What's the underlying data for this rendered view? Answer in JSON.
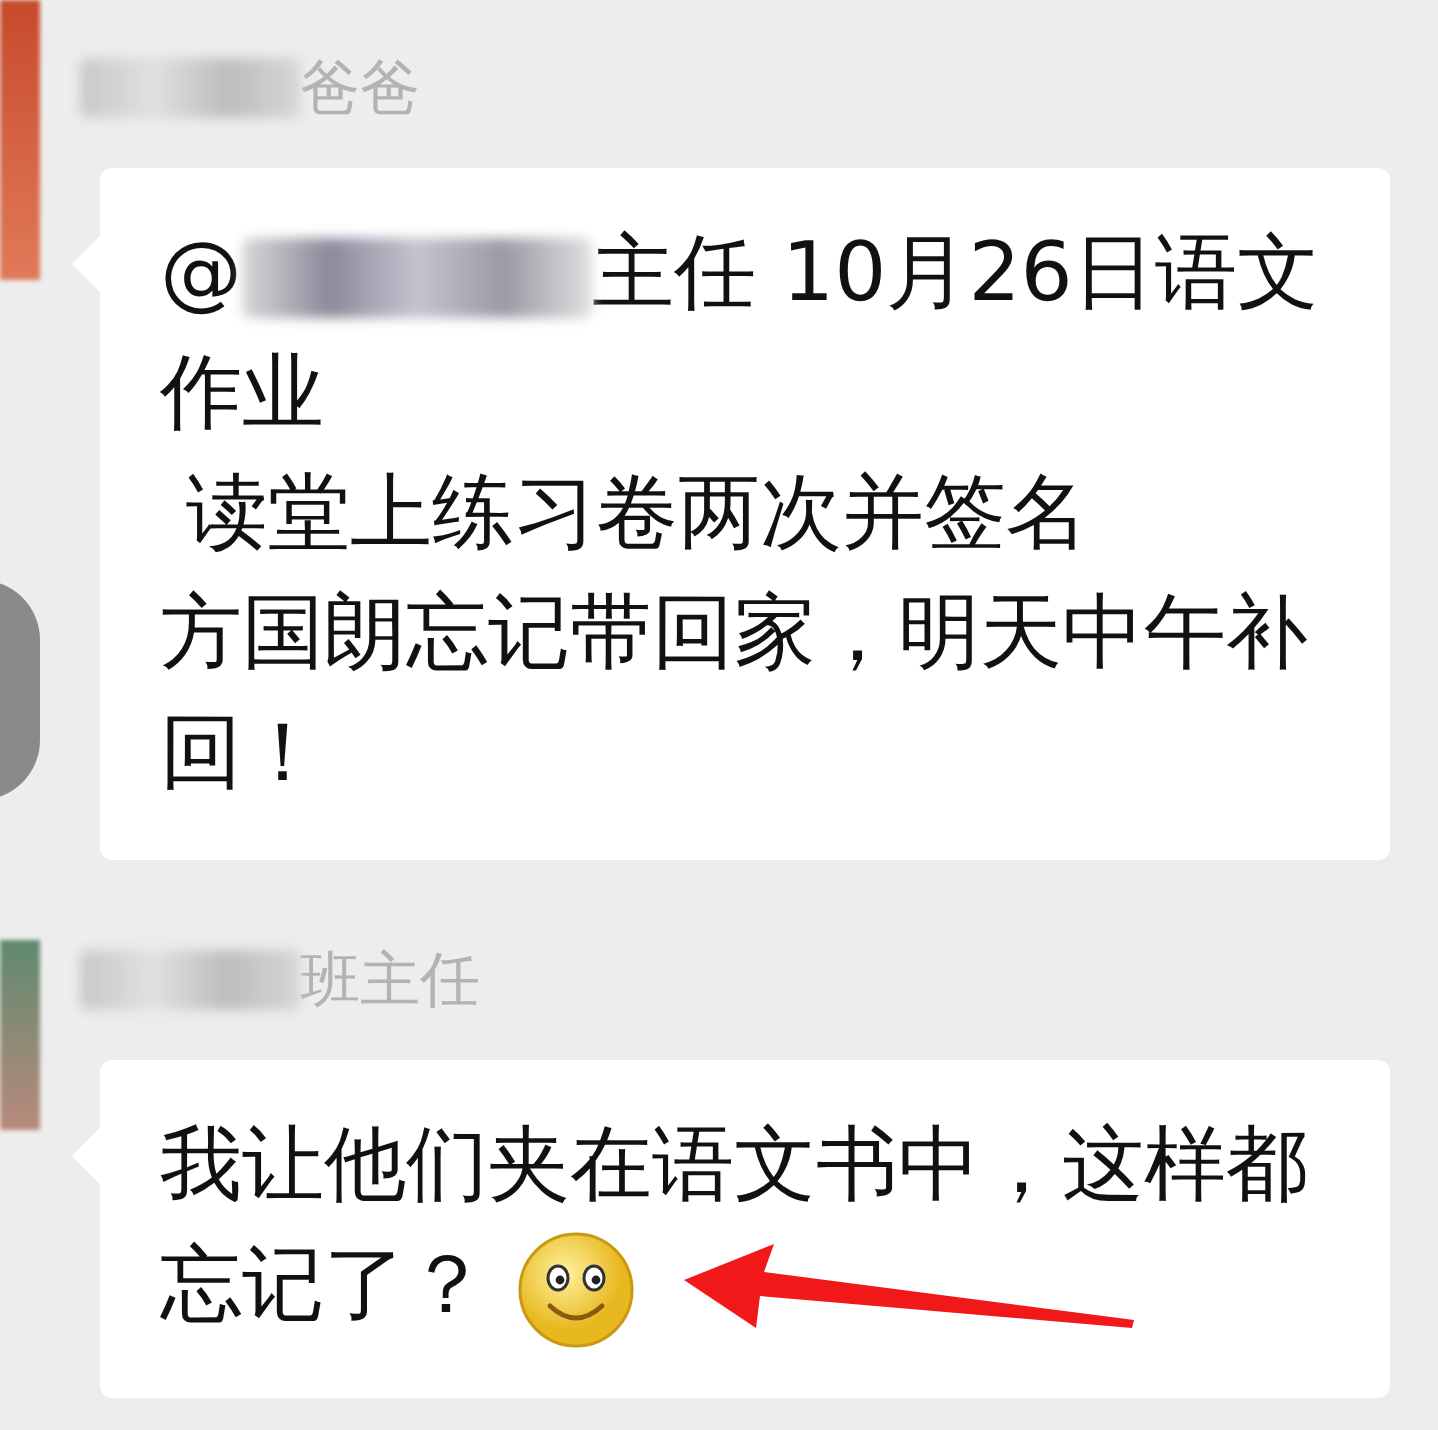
{
  "messages": [
    {
      "sender": {
        "redacted": true,
        "name": "爸爸"
      },
      "mention": {
        "prefix": "@",
        "redacted": true,
        "suffix": "主任 10月26日语文"
      },
      "lines": [
        "作业",
        " 读堂上练习卷两次并签名",
        "方国朗忘记带回家，明天中午补",
        "回！"
      ]
    },
    {
      "sender": {
        "redacted": true,
        "name": "班主任"
      },
      "lines": [
        "我让他们夹在语文书中，这样都",
        "忘记了？"
      ],
      "emoji": {
        "kind": "smile"
      },
      "annotation": {
        "kind": "arrow"
      }
    }
  ]
}
